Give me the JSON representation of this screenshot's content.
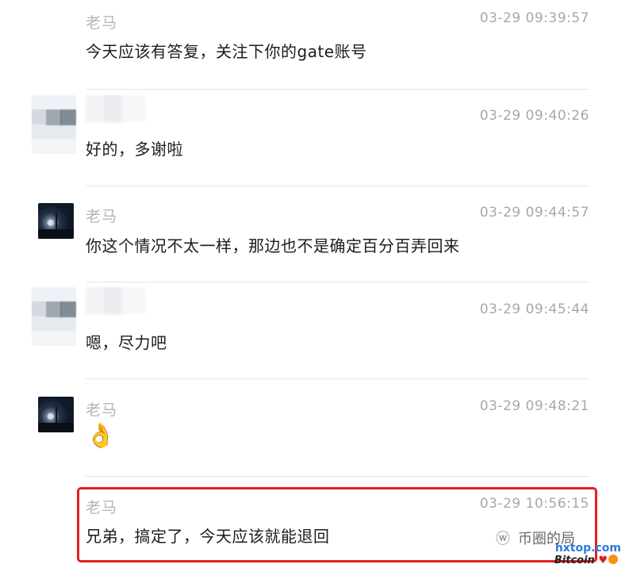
{
  "messages": [
    {
      "name": "老马",
      "time": "03-29 09:39:57",
      "text": "今天应该有答复，关注下你的gate账号"
    },
    {
      "name": "",
      "time": "03-29 09:40:26",
      "text": "好的，多谢啦"
    },
    {
      "name": "老马",
      "time": "03-29 09:44:57",
      "text": "你这个情况不太一样，那边也不是确定百分百弄回来"
    },
    {
      "name": "",
      "time": "03-29 09:45:44",
      "text": "嗯，尽力吧"
    },
    {
      "name": "老马",
      "time": "03-29 09:48:21",
      "text": "👌"
    },
    {
      "name": "老马",
      "time": "03-29 10:56:15",
      "text": "兄弟，搞定了，今天应该就能退回"
    }
  ],
  "watermark": {
    "title": "币圈的局",
    "site": "hxtop.com",
    "brand": "Bitcoin"
  },
  "colors": {
    "highlight": "#e02020",
    "text": "#1c1c1c",
    "meta": "#a8a8a8"
  },
  "icons": [
    "wechat-official-account-icon",
    "heart-icon",
    "bitcoin-icon"
  ]
}
